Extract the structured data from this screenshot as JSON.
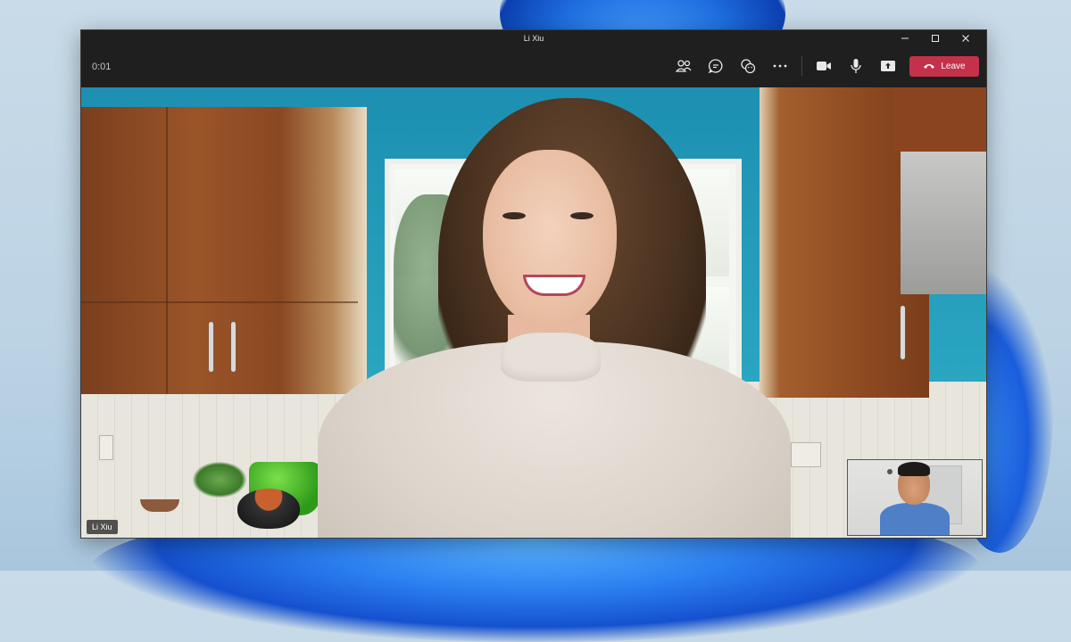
{
  "window": {
    "title": "Li Xiu",
    "controls": [
      "minimize",
      "maximize",
      "close"
    ]
  },
  "call": {
    "timer": "0:01",
    "leave_label": "Leave"
  },
  "toolbar": {
    "icons": [
      "people-icon",
      "chat-icon",
      "reactions-icon",
      "more-icon",
      "camera-icon",
      "microphone-icon",
      "share-screen-icon"
    ]
  },
  "participant": {
    "name": "Li Xiu"
  },
  "colors": {
    "leave_button": "#c4314b",
    "window_background": "#1f1f1f"
  }
}
